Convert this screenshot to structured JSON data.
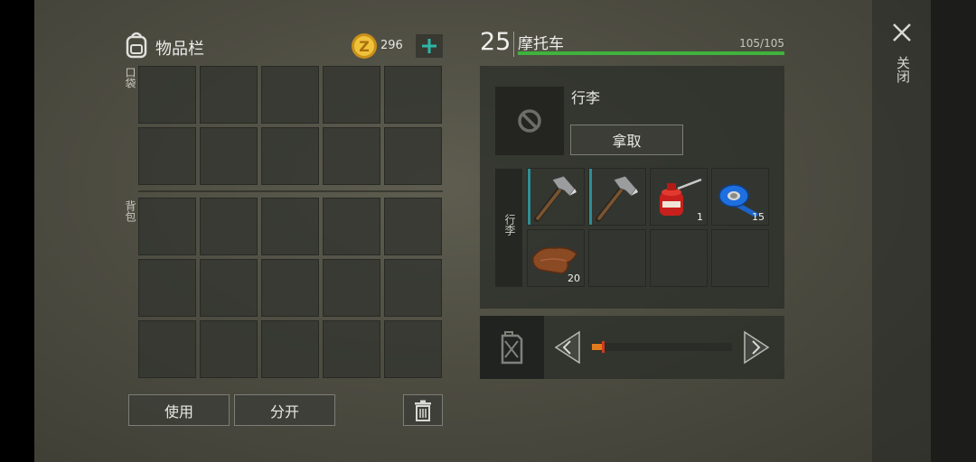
{
  "inventory": {
    "title": "物品栏",
    "currency": "296",
    "pockets_label": "口袋",
    "backpack_label": "背包",
    "use_button": "使用",
    "split_button": "分开"
  },
  "vehicle": {
    "level": "25",
    "name": "摩托车",
    "durability": "105/105",
    "durability_fraction": 1.0,
    "slot_label": "行李",
    "take_button": "拿取",
    "storage_label": "行李",
    "items": [
      {
        "name": "hatchet-icon",
        "qty": ""
      },
      {
        "name": "hatchet-icon",
        "qty": ""
      },
      {
        "name": "oil-can-icon",
        "qty": "1"
      },
      {
        "name": "duct-tape-icon",
        "qty": "15"
      },
      {
        "name": "leather-icon",
        "qty": "20"
      }
    ],
    "fuel_level_fraction": 0.08
  },
  "close_label": "关闭",
  "colors": {
    "accent_green": "#3fb33c",
    "plus_teal": "#2fb5a8",
    "fuel_orange": "#e07a1c"
  }
}
